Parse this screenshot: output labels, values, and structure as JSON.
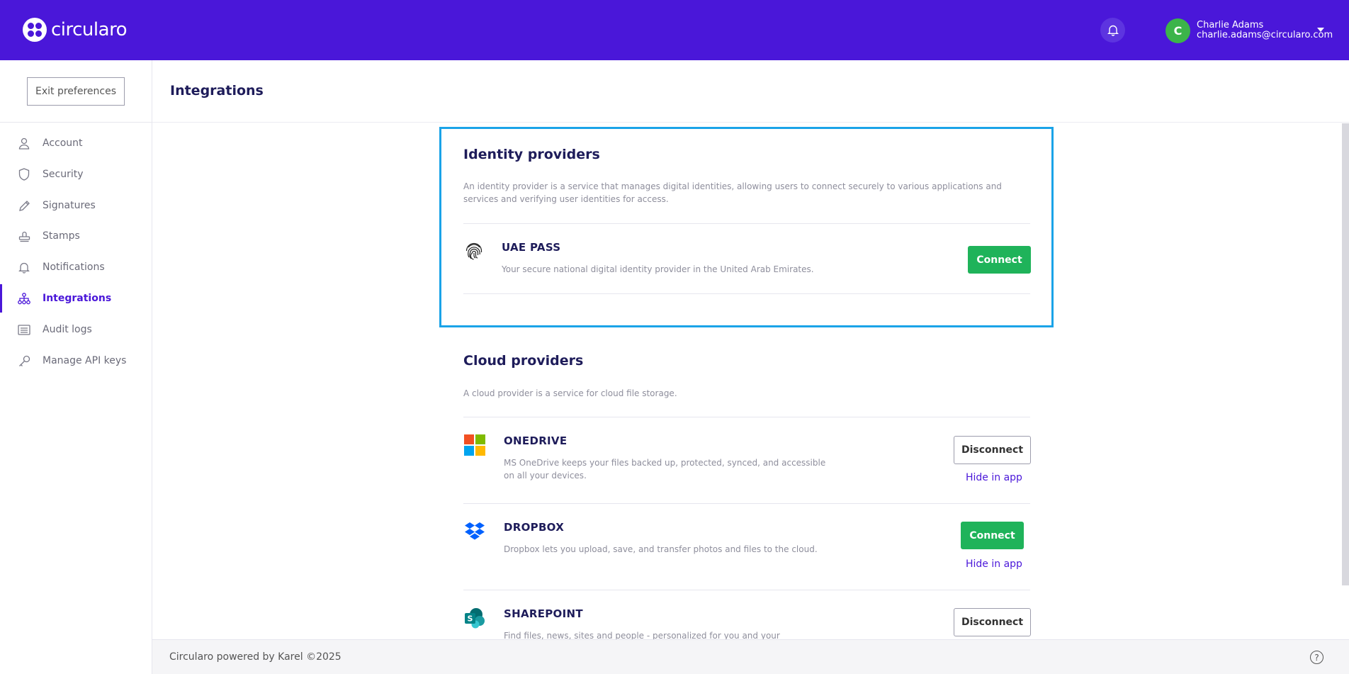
{
  "app": {
    "name": "circularo"
  },
  "user": {
    "initial": "C",
    "name": "Charlie Adams",
    "email": "charlie.adams@circularo.com"
  },
  "sidebar": {
    "exit_label": "Exit preferences",
    "items": [
      {
        "label": "Account",
        "icon": "user-icon"
      },
      {
        "label": "Security",
        "icon": "shield-icon"
      },
      {
        "label": "Signatures",
        "icon": "pen-icon"
      },
      {
        "label": "Stamps",
        "icon": "stamp-icon"
      },
      {
        "label": "Notifications",
        "icon": "bell-icon"
      },
      {
        "label": "Integrations",
        "icon": "network-icon",
        "active": true
      },
      {
        "label": "Audit logs",
        "icon": "list-icon"
      },
      {
        "label": "Manage API keys",
        "icon": "key-icon"
      }
    ]
  },
  "page": {
    "title": "Integrations"
  },
  "identity": {
    "title": "Identity providers",
    "description": "An identity provider is a service that manages digital identities, allowing users to connect securely to various applications and services and verifying user identities for access.",
    "providers": [
      {
        "name": "UAE PASS",
        "description": "Your secure national digital identity provider in the United Arab Emirates.",
        "action": "Connect"
      }
    ]
  },
  "cloud": {
    "title": "Cloud providers",
    "description": "A cloud provider is a service for cloud file storage.",
    "providers": [
      {
        "name": "ONEDRIVE",
        "description": "MS OneDrive keeps your files backed up, protected, synced, and accessible on all your devices.",
        "action": "Disconnect",
        "hide_label": "Hide in app"
      },
      {
        "name": "DROPBOX",
        "description": "Dropbox lets you upload, save, and transfer photos and files to the cloud.",
        "action": "Connect",
        "hide_label": "Hide in app"
      },
      {
        "name": "SHAREPOINT",
        "description": "Find files, news, sites and people - personalized for you and your organization.",
        "action": "Disconnect"
      }
    ]
  },
  "footer": {
    "text": "Circularo powered by Karel ©2025",
    "help_glyph": "?"
  },
  "colors": {
    "brand": "#4a17d9",
    "connect": "#1fb35a",
    "highlight": "#1aa3e8"
  }
}
